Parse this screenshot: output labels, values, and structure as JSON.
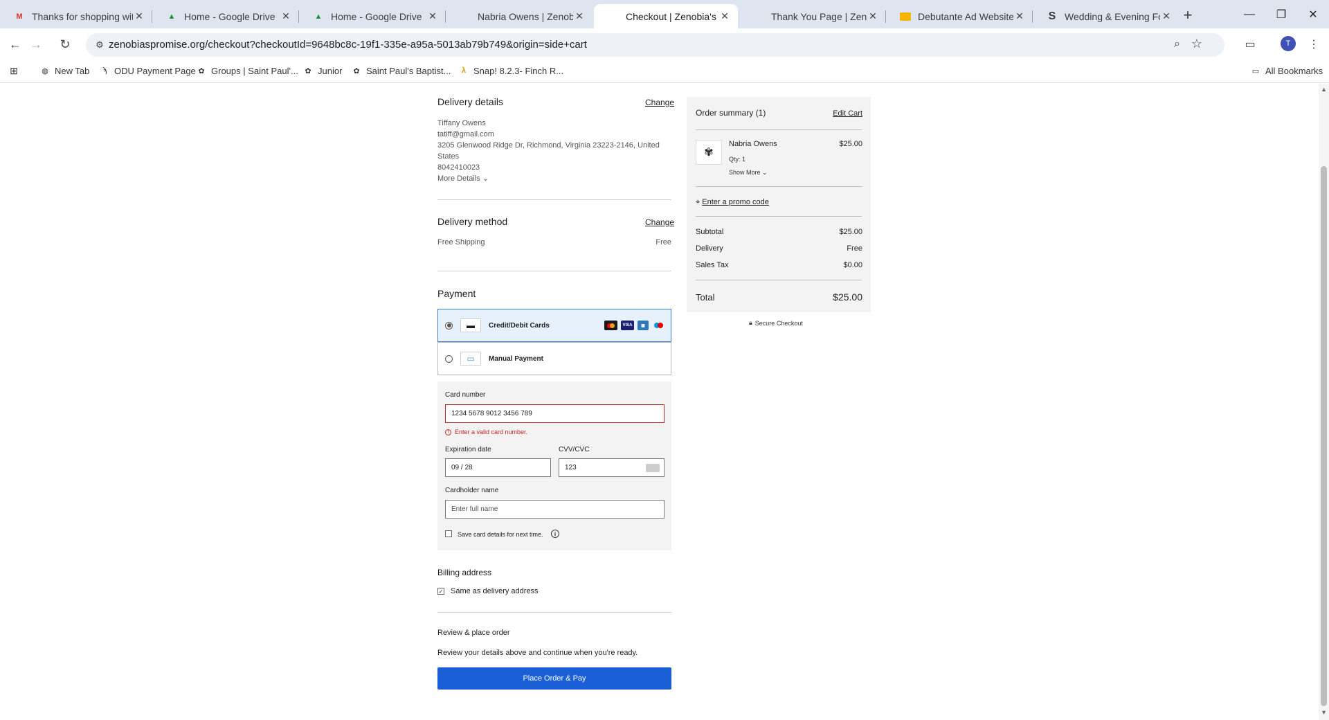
{
  "browser": {
    "tabs": [
      {
        "title": "Thanks for shopping with",
        "icon": "gmail-icon",
        "active": false
      },
      {
        "title": "Home - Google Drive",
        "icon": "drive-icon",
        "active": false
      },
      {
        "title": "Home - Google Drive",
        "icon": "drive-icon",
        "active": false
      },
      {
        "title": "Nabria Owens | Zenobia's",
        "icon": "site-icon",
        "active": false
      },
      {
        "title": "Checkout | Zenobia's Prom",
        "icon": "site-icon",
        "active": true
      },
      {
        "title": "Thank You Page | Zenobia",
        "icon": "site-icon",
        "active": false
      },
      {
        "title": "Debutante Ad Website Tra",
        "icon": "slides-icon",
        "active": false
      },
      {
        "title": "Wedding & Evening Form",
        "icon": "s-icon",
        "active": false
      }
    ],
    "url": "zenobiaspromise.org/checkout?checkoutId=9648bc8c-19f1-335e-a95a-5013ab79b749&origin=side+cart",
    "avatar_letter": "T",
    "bookmarks": [
      {
        "label": "New Tab"
      },
      {
        "label": "ODU Payment Page"
      },
      {
        "label": "Groups | Saint Paul'..."
      },
      {
        "label": "Junior"
      },
      {
        "label": "Saint Paul's Baptist..."
      },
      {
        "label": "Snap! 8.2.3- Finch R..."
      }
    ],
    "all_bookmarks": "All Bookmarks"
  },
  "delivery_details": {
    "heading": "Delivery details",
    "change": "Change",
    "name": "Tiffany Owens",
    "email": "tatiff@gmail.com",
    "address_line1": "3205 Glenwood Ridge Dr, Richmond, Virginia 23223-2146, United",
    "address_line2": "States",
    "phone": "8042410023",
    "more_details": "More Details"
  },
  "delivery_method": {
    "heading": "Delivery method",
    "change": "Change",
    "method": "Free Shipping",
    "price": "Free"
  },
  "payment": {
    "heading": "Payment",
    "options": [
      {
        "label": "Credit/Debit Cards",
        "selected": true
      },
      {
        "label": "Manual Payment",
        "selected": false
      }
    ],
    "card_logos": [
      "mastercard-icon",
      "visa-icon",
      "amex-icon",
      "maestro-icon"
    ],
    "visa_text": "VISA",
    "card_number_label": "Card number",
    "card_number_value": "1234 5678 9012 3456 789",
    "card_number_error": "Enter a valid card number.",
    "expiration_label": "Expiration date",
    "expiration_value": "09 / 28",
    "cvv_label": "CVV/CVC",
    "cvv_value": "123",
    "cardholder_label": "Cardholder name",
    "cardholder_placeholder": "Enter full name",
    "save_card_label": "Save card details for next time."
  },
  "billing": {
    "heading": "Billing address",
    "same_as_delivery": "Same as delivery address",
    "checked": true
  },
  "review": {
    "heading": "Review & place order",
    "text": "Review your details above and continue when you're ready.",
    "button": "Place Order & Pay"
  },
  "summary": {
    "title": "Order summary (1)",
    "edit_cart": "Edit Cart",
    "item_name": "Nabria Owens",
    "item_price": "$25.00",
    "item_qty": "Qty: 1",
    "show_more": "Show More",
    "promo": "Enter a promo code",
    "subtotal_label": "Subtotal",
    "subtotal_value": "$25.00",
    "delivery_label": "Delivery",
    "delivery_value": "Free",
    "tax_label": "Sales Tax",
    "tax_value": "$0.00",
    "total_label": "Total",
    "total_value": "$25.00",
    "secure": "Secure Checkout"
  },
  "colors": {
    "accent": "#1a5fd6",
    "error": "#c5221f",
    "summary_bg": "#f3f3f3"
  }
}
